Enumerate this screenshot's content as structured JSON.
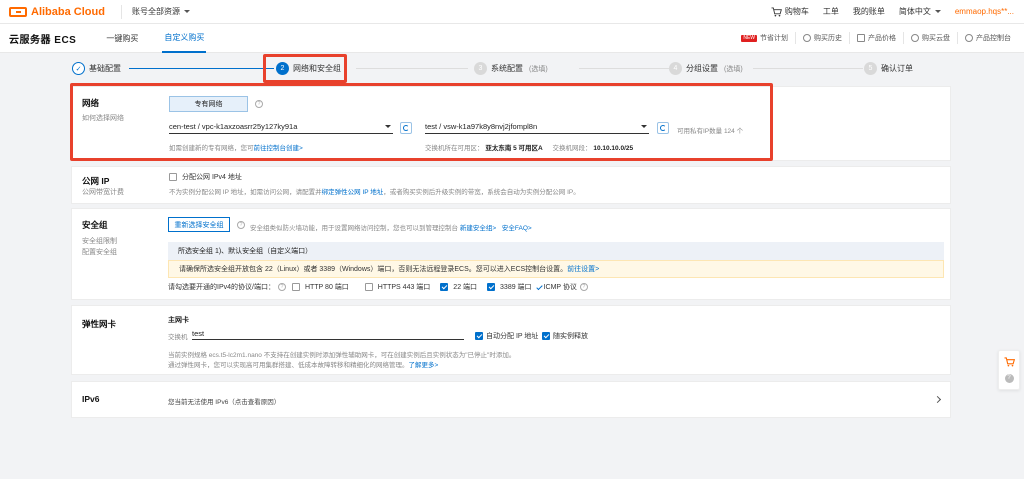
{
  "topbar": {
    "brand": "Alibaba Cloud",
    "resource_switch": "账号全部资源",
    "cart": "购物车",
    "ticket": "工单",
    "bills": "我的账单",
    "language": "简体中文",
    "user": "emmaop.hqs**..."
  },
  "subhead": {
    "product_title": "云服务器 ECS",
    "tabs": [
      {
        "label": "一键购买"
      },
      {
        "label": "自定义购买"
      }
    ],
    "right_items": [
      {
        "badge": "NEW",
        "label": "节省计划"
      },
      {
        "label": "购买历史"
      },
      {
        "label": "产品价格"
      },
      {
        "label": "购买云盘"
      },
      {
        "label": "产品控制台"
      }
    ]
  },
  "steps": [
    {
      "num": "✓",
      "label": "基础配置",
      "sub": ""
    },
    {
      "num": "2",
      "label": "网络和安全组",
      "sub": ""
    },
    {
      "num": "3",
      "label": "系统配置",
      "sub": "(选填)"
    },
    {
      "num": "4",
      "label": "分组设置",
      "sub": "(选填)"
    },
    {
      "num": "5",
      "label": "确认订单",
      "sub": ""
    }
  ],
  "network": {
    "title": "网络",
    "desc": "如何选择网络",
    "vpc_button": "专有网络",
    "vpc_select": "cen-test / vpc-k1axzoasrr25y127ky91a",
    "vsw_select": "test / vsw-k1a97k8y8nvj2jfompl8n",
    "ip_available": "可用私有IP数量 124 个",
    "vpc_hint_prefix": "如需创建新的专有网络，您可",
    "vpc_hint_link": "前往控制台创建>",
    "zone_label": "交换机所在可用区：",
    "zone_value": "亚太东南 5 可用区A",
    "cidr_label": "交换机网段：",
    "cidr_value": "10.10.10.0/25"
  },
  "public_ip": {
    "title": "公网 IP",
    "desc": "公网带宽计费",
    "checkbox_label": "分配公网 IPv4 地址",
    "hint_prefix": "不为实例分配公网 IP 地址，如需访问公网，请配置并",
    "hint_link": "绑定弹性公网 IP 地址",
    "hint_suffix": "，或者购买实例后升级实例的带宽，系统会自动为实例分配公网 IP。"
  },
  "security_group": {
    "title": "安全组",
    "desc1": "安全组限制",
    "desc2": "配置安全组",
    "reselect_button": "重新选择安全组",
    "hint_prefix": "安全组类似防火墙功能，用于设置网络访问控制，您也可以到管理控制台",
    "hint_link1": "新建安全组>",
    "hint_link2": "安全FAQ>",
    "selected": "所选安全组 1)、默认安全组（自定义端口）",
    "warning_prefix": "请确保所选安全组开放包含 22（Linux）或者 3389（Windows）端口，否则无法远程登录ECS。您可以进入ECS控制台设置。",
    "warning_link": "前往设置>",
    "ports_label": "请勾选要开通的IPv4的协议/端口：",
    "ports": [
      {
        "label": "HTTP 80 端口",
        "checked": false
      },
      {
        "label": "HTTPS 443 端口",
        "checked": false
      },
      {
        "label": "22 端口",
        "checked": true
      },
      {
        "label": "3389 端口",
        "checked": true
      }
    ],
    "icmp_label": "ICMP 协议"
  },
  "eni": {
    "title": "弹性网卡",
    "primary_label": "主网卡",
    "switch_label": "交换机",
    "switch_value": "test",
    "auto_ip_label": "自动分配 IP 地址",
    "release_label": "随实例释放",
    "note1": "当前实例规格 ecs.t5-lc2m1.nano 不支持在创建实例时添加弹性辅助网卡，可在创建实例后且实例状态为\"已停止\"时添加。",
    "note2_prefix": "通过弹性网卡，您可以实现高可用集群搭建、低成本故障转移和精细化的网络管理。",
    "note2_link": "了解更多>"
  },
  "ipv6": {
    "title": "IPv6",
    "text": "您当前无法使用 IPv6（点击查看原因）"
  },
  "colors": {
    "accent": "#0070cc",
    "brand": "#ff6a00",
    "highlight_red": "#e8412c"
  }
}
